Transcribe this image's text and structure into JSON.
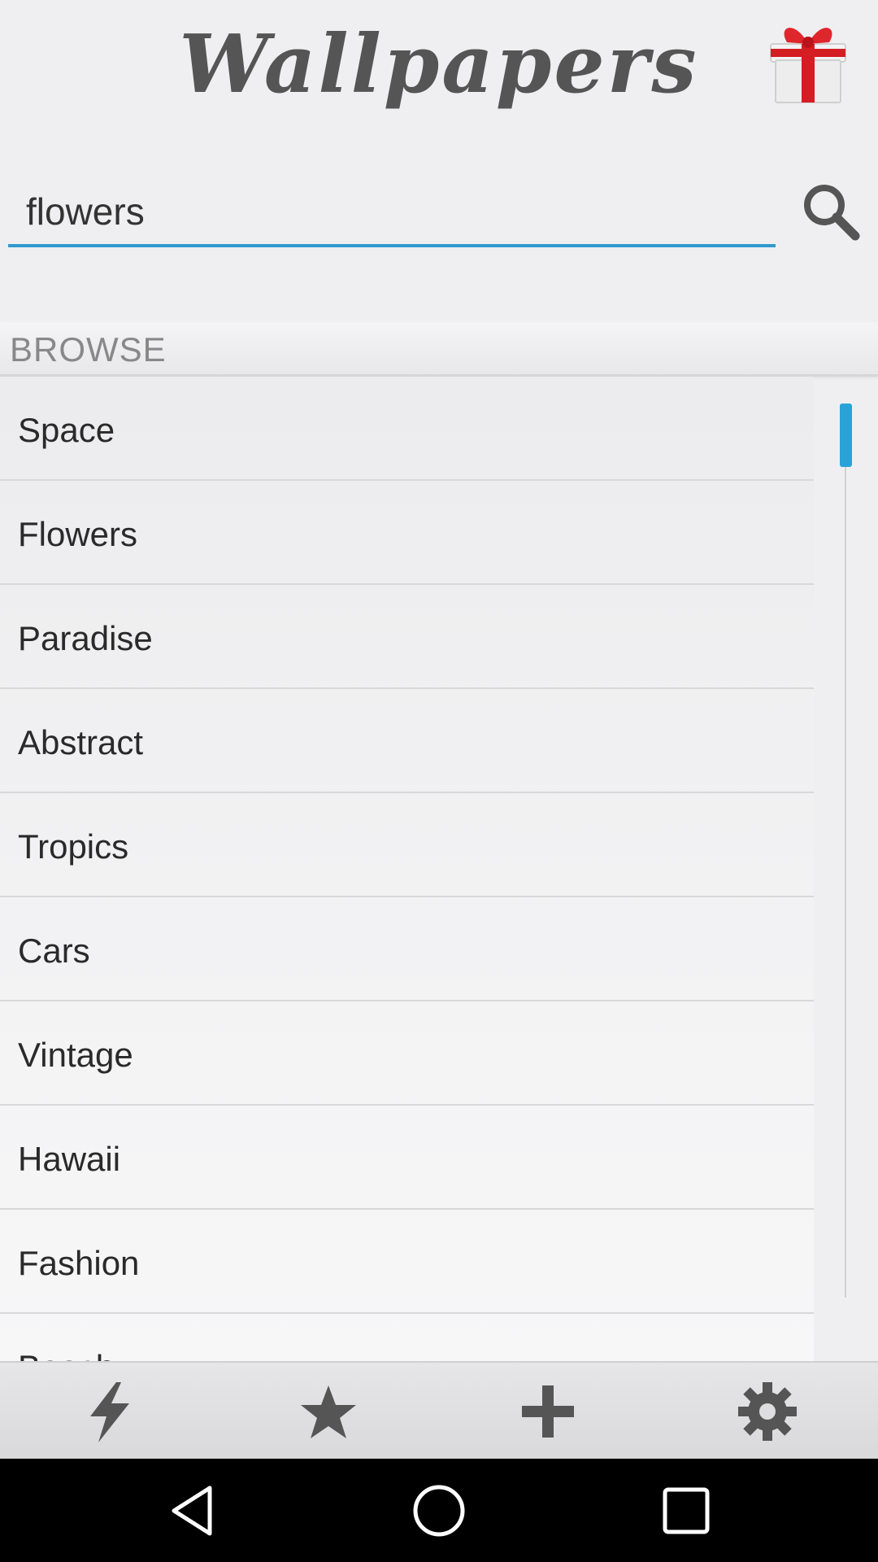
{
  "header": {
    "title": "Wallpapers",
    "gift_icon": "gift-icon",
    "gift_colors": {
      "box": "#f1f1f1",
      "ribbon": "#d51d24"
    }
  },
  "search": {
    "value": "flowers",
    "icon": "search-icon"
  },
  "browse": {
    "label": "BROWSE",
    "items": [
      {
        "label": "Space"
      },
      {
        "label": "Flowers"
      },
      {
        "label": "Paradise"
      },
      {
        "label": "Abstract"
      },
      {
        "label": "Tropics"
      },
      {
        "label": "Cars"
      },
      {
        "label": "Vintage"
      },
      {
        "label": "Hawaii"
      },
      {
        "label": "Fashion"
      },
      {
        "label": "Beach"
      }
    ]
  },
  "toolbar": {
    "items": [
      {
        "icon": "lightning-icon"
      },
      {
        "icon": "star-icon"
      },
      {
        "icon": "plus-icon"
      },
      {
        "icon": "gear-icon"
      }
    ]
  },
  "navbar": {
    "items": [
      {
        "icon": "back-icon"
      },
      {
        "icon": "home-icon"
      },
      {
        "icon": "recents-icon"
      }
    ]
  },
  "colors": {
    "accent": "#2f9bcf",
    "background": "#efeff1",
    "text": "#2a2a2a",
    "muted": "#888888",
    "toolbar_icon": "#555555"
  }
}
